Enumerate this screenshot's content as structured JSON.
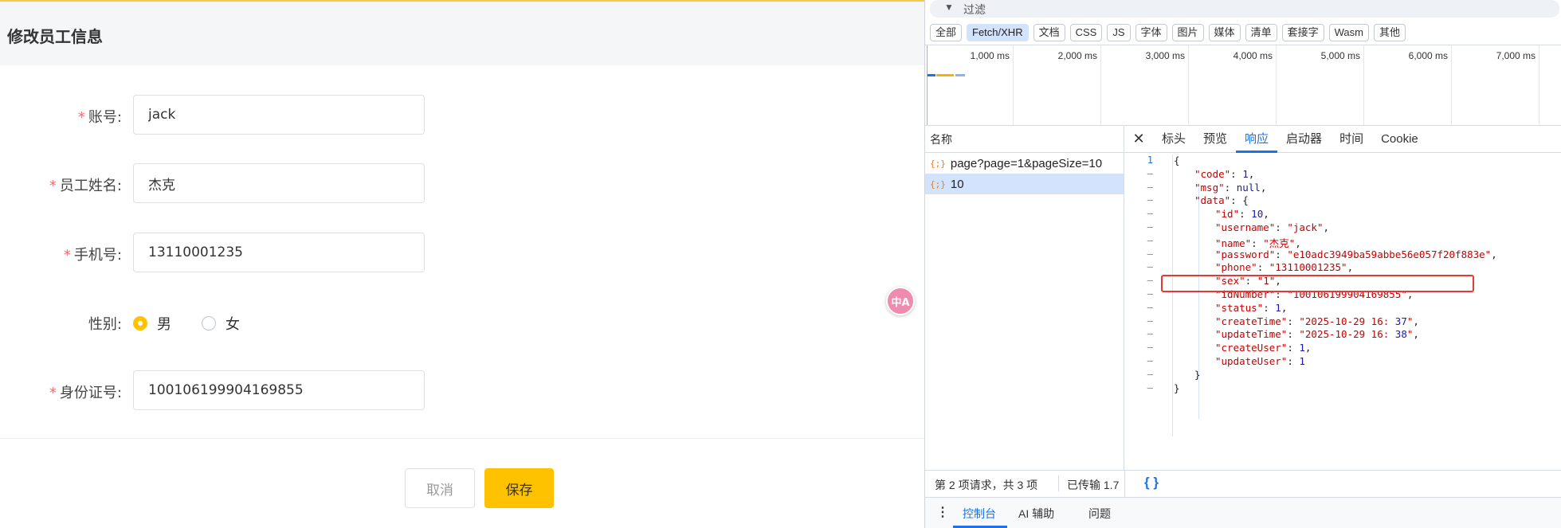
{
  "form": {
    "title": "修改员工信息",
    "fields": {
      "username": {
        "label": "账号:",
        "value": "jack"
      },
      "name": {
        "label": "员工姓名:",
        "value": "杰克"
      },
      "phone": {
        "label": "手机号:",
        "value": "13110001235"
      },
      "sex": {
        "label": "性别:",
        "options": [
          "男",
          "女"
        ],
        "selected": "男"
      },
      "id_number": {
        "label": "身份证号:",
        "value": "100106199904169855"
      }
    },
    "required_mark": "*",
    "cancel_label": "取消",
    "save_label": "保存",
    "translate_fab_label": "中A"
  },
  "devtools": {
    "filter_placeholder": "过滤",
    "type_filters": [
      "全部",
      "Fetch/XHR",
      "文档",
      "CSS",
      "JS",
      "字体",
      "图片",
      "媒体",
      "清单",
      "套接字",
      "Wasm",
      "其他"
    ],
    "active_filter": "Fetch/XHR",
    "timeline_ticks": [
      "1,000 ms",
      "2,000 ms",
      "3,000 ms",
      "4,000 ms",
      "5,000 ms",
      "6,000 ms",
      "7,000 ms"
    ],
    "name_column_header": "名称",
    "requests": [
      {
        "name": "page?page=1&pageSize=10",
        "selected": false
      },
      {
        "name": "10",
        "selected": true
      }
    ],
    "detail_tabs": [
      "标头",
      "预览",
      "响应",
      "启动器",
      "时间",
      "Cookie"
    ],
    "active_detail_tab": "响应",
    "response_lines": [
      "{",
      "\"code\": 1,",
      "\"msg\": null,",
      "\"data\": {",
      "\"id\": 10,",
      "\"username\": \"jack\",",
      "\"name\": \"杰克\",",
      "\"password\": \"e10adc3949ba59abbe56e057f20f883e\",",
      "\"phone\": \"13110001235\",",
      "\"sex\": \"1\",",
      "\"idNumber\": \"100106199904169855\",",
      "\"status\": 1,",
      "\"createTime\": \"2025-10-29 16:37\",",
      "\"updateTime\": \"2025-10-29 16:38\",",
      "\"createUser\": 1,",
      "\"updateUser\": 1",
      "}",
      "}"
    ],
    "first_line_number": "1",
    "fold_marker": "–",
    "status_requests": "第 2 项请求，共 3 项",
    "status_transferred": "已传输 1.7",
    "pretty_print_label": "{ }",
    "drawer_tabs": [
      "控制台",
      "AI 辅助",
      "问题"
    ],
    "active_drawer_tab": "控制台",
    "colors": {
      "accent": "#1a73e8",
      "save_button": "#ffc200",
      "highlight": "#e53935"
    }
  }
}
